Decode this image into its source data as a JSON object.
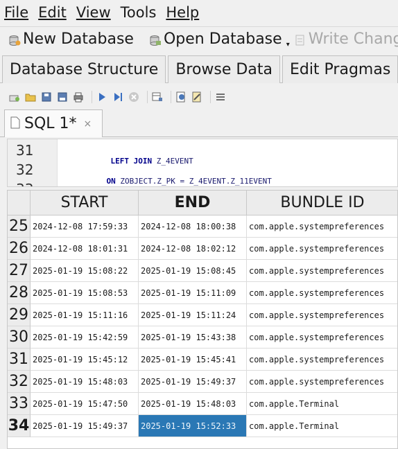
{
  "menu": [
    "File",
    "Edit",
    "View",
    "Tools",
    "Help"
  ],
  "toolbar": {
    "new_db": "New Database",
    "open_db": "Open Database",
    "write_changes": "Write Chang"
  },
  "tabs": [
    "Database Structure",
    "Browse Data",
    "Edit Pragmas"
  ],
  "sql_tab": {
    "label": "SQL 1*",
    "close": "×"
  },
  "editor": {
    "lines": [
      {
        "num": "31",
        "kw": "LEFT JOIN",
        "rest": " Z_4EVENT"
      },
      {
        "num": "32",
        "kw": "ON",
        "rest": " ZOBJECT.Z_PK = Z_4EVENT.Z_11EVENT"
      }
    ]
  },
  "results": {
    "columns": [
      "START",
      "END",
      "BUNDLE ID"
    ],
    "rows": [
      {
        "n": "25",
        "start": "2024-12-08 17:59:33",
        "end": "2024-12-08 18:00:38",
        "bundle": "com.apple.systempreferences"
      },
      {
        "n": "26",
        "start": "2024-12-08 18:01:31",
        "end": "2024-12-08 18:02:12",
        "bundle": "com.apple.systempreferences"
      },
      {
        "n": "27",
        "start": "2025-01-19 15:08:22",
        "end": "2025-01-19 15:08:45",
        "bundle": "com.apple.systempreferences"
      },
      {
        "n": "28",
        "start": "2025-01-19 15:08:53",
        "end": "2025-01-19 15:11:09",
        "bundle": "com.apple.systempreferences"
      },
      {
        "n": "29",
        "start": "2025-01-19 15:11:16",
        "end": "2025-01-19 15:11:24",
        "bundle": "com.apple.systempreferences"
      },
      {
        "n": "30",
        "start": "2025-01-19 15:42:59",
        "end": "2025-01-19 15:43:38",
        "bundle": "com.apple.systempreferences"
      },
      {
        "n": "31",
        "start": "2025-01-19 15:45:12",
        "end": "2025-01-19 15:45:41",
        "bundle": "com.apple.systempreferences"
      },
      {
        "n": "32",
        "start": "2025-01-19 15:48:03",
        "end": "2025-01-19 15:49:37",
        "bundle": "com.apple.systempreferences"
      },
      {
        "n": "33",
        "start": "2025-01-19 15:47:50",
        "end": "2025-01-19 15:48:03",
        "bundle": "com.apple.Terminal"
      },
      {
        "n": "34",
        "start": "2025-01-19 15:49:37",
        "end": "2025-01-19 15:52:33",
        "bundle": "com.apple.Terminal"
      }
    ]
  },
  "colors": {
    "selection": "#2a78b5",
    "keyword": "#00008b"
  }
}
